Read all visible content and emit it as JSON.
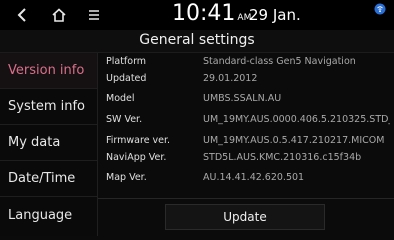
{
  "status_bar": {
    "time": "10:41",
    "ampm": "AM",
    "date": "29 Jan.",
    "icons": {
      "back": "back-arrow-icon",
      "home": "home-icon",
      "menu": "menu-icon",
      "connection": "wireless-status-icon"
    }
  },
  "header": {
    "title": "General settings"
  },
  "sidebar": {
    "items": [
      {
        "label": "Version info",
        "active": true
      },
      {
        "label": "System info",
        "active": false
      },
      {
        "label": "My data",
        "active": false
      },
      {
        "label": "Date/Time",
        "active": false
      },
      {
        "label": "Language",
        "active": false
      }
    ]
  },
  "info": {
    "rows": [
      {
        "label": "Platform",
        "value": "Standard-class Gen5 Navigation"
      },
      {
        "label": "Updated",
        "value": "29.01.2012"
      },
      {
        "label": "Model",
        "value": "UMBS.SSALN.AU"
      },
      {
        "label": "SW Ver.",
        "value": "UM_19MY.AUS.0000.406.5.210325.STD_M"
      },
      {
        "label": "Firmware ver.",
        "value": "UM_19MY.AUS.0.5.417.210217.MICOM"
      },
      {
        "label": "NaviApp Ver.",
        "value": "STD5L.AUS.KMC.210316.c15f34b"
      },
      {
        "label": "Map Ver.",
        "value": "AU.14.41.42.620.501"
      }
    ]
  },
  "actions": {
    "update_label": "Update"
  },
  "colors": {
    "accent": "#d8708a",
    "background": "#0b0b0b"
  }
}
